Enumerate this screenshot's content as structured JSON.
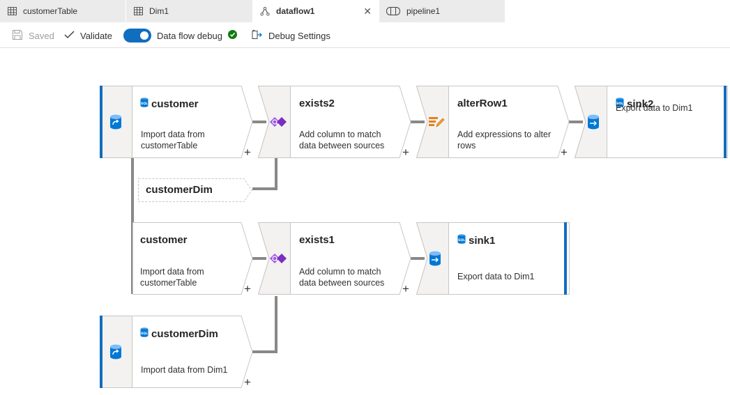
{
  "tabs": [
    {
      "label": "customerTable",
      "icon": "table-icon"
    },
    {
      "label": "Dim1",
      "icon": "table-icon"
    },
    {
      "label": "dataflow1",
      "icon": "dataflow-icon",
      "active": true
    },
    {
      "label": "pipeline1",
      "icon": "pipeline-icon"
    }
  ],
  "toolbar": {
    "saved_label": "Saved",
    "validate_label": "Validate",
    "debug_label": "Data flow debug",
    "debug_settings_label": "Debug Settings"
  },
  "colors": {
    "accent": "#106ebe",
    "node_border": "#c8c6c4",
    "connector": "#8a8886",
    "success": "#107c10"
  },
  "flow": {
    "customer1": {
      "title": "customer",
      "desc1": "Import data from",
      "desc2": "customerTable"
    },
    "exists2": {
      "title": "exists2",
      "desc1": "Add column to match",
      "desc2": "data between sources"
    },
    "alterRow1": {
      "title": "alterRow1",
      "desc1": "Add expressions to alter",
      "desc2": "rows"
    },
    "sink2": {
      "title": "sink2",
      "desc": "Export data to Dim1"
    },
    "ref_customerDim": {
      "title": "customerDim"
    },
    "customer2": {
      "title": "customer",
      "desc1": "Import data from",
      "desc2": "customerTable"
    },
    "exists1": {
      "title": "exists1",
      "desc1": "Add column to match",
      "desc2": "data between sources"
    },
    "sink1": {
      "title": "sink1",
      "desc": "Export data to Dim1"
    },
    "customerDim": {
      "title": "customerDim",
      "desc": "Import data from Dim1"
    },
    "plus_label": "+"
  }
}
